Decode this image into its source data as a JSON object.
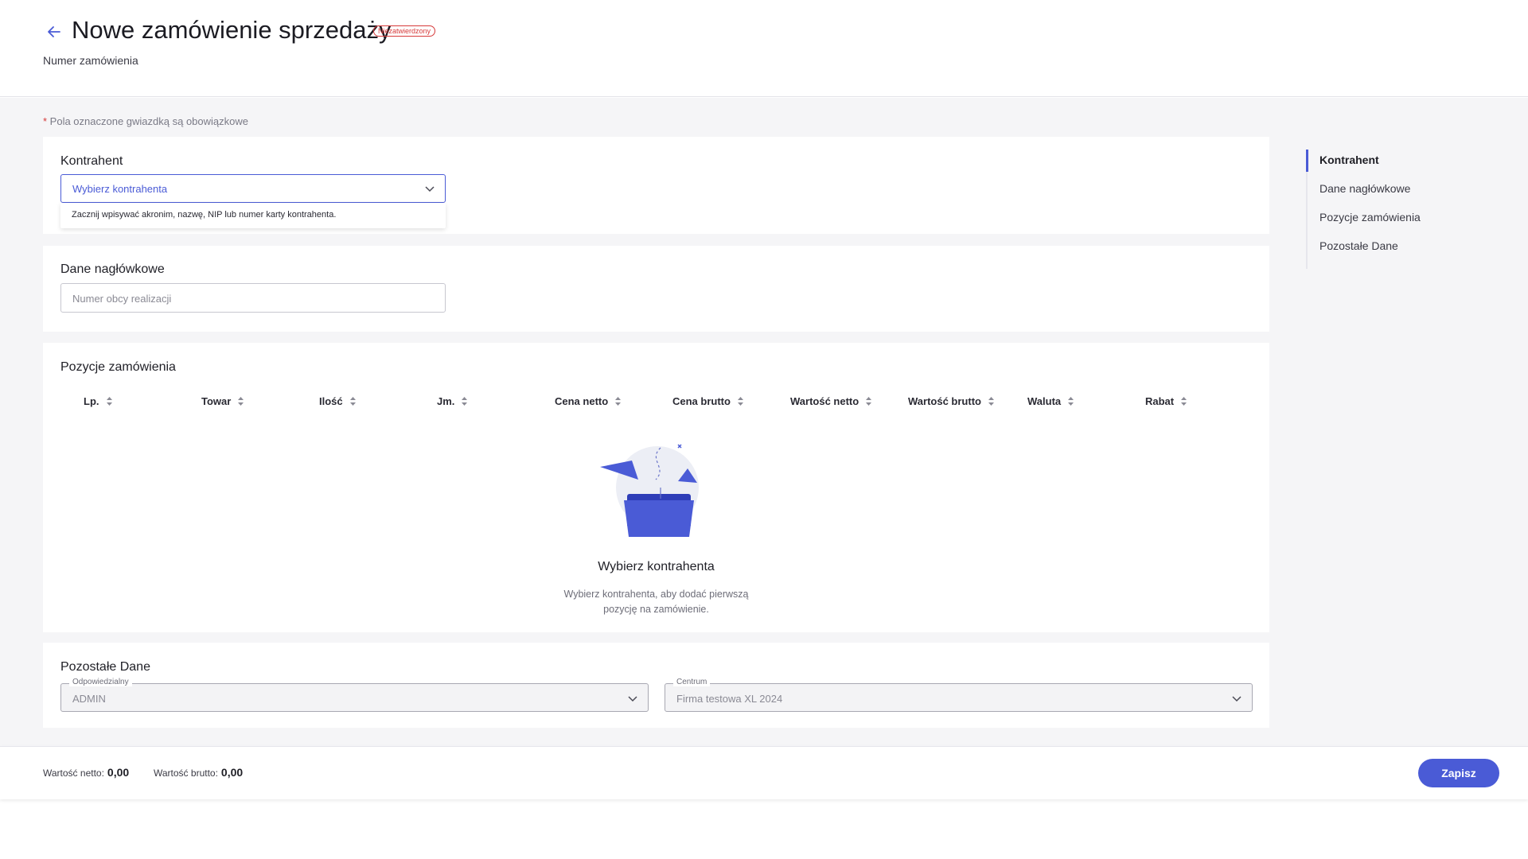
{
  "header": {
    "title": "Nowe zamówienie sprzedaży",
    "status_badge": "Niezatwierdzony",
    "order_number_label": "Numer zamówienia"
  },
  "required_note": {
    "star": "*",
    "text": " Pola oznaczone gwiazdką są obowiązkowe"
  },
  "kontrahent": {
    "title": "Kontrahent",
    "select_value": "Wybierz kontrahenta",
    "hint": "Zacznij wpisywać akronim, nazwę, NIP lub numer karty kontrahenta."
  },
  "dane_naglowkowe": {
    "title": "Dane nagłówkowe",
    "foreign_number_placeholder": "Numer obcy realizacji"
  },
  "pozycje": {
    "title": "Pozycje zamówienia",
    "columns": [
      "Lp.",
      "Towar",
      "Ilość",
      "Jm.",
      "Cena netto",
      "Cena brutto",
      "Wartość netto",
      "Wartość brutto",
      "Waluta",
      "Rabat"
    ],
    "empty_title": "Wybierz kontrahenta",
    "empty_desc": "Wybierz kontrahenta, aby dodać pierwszą pozycję na zamówienie."
  },
  "pozostale": {
    "title": "Pozostałe Dane",
    "responsible_label": "Odpowiedzialny",
    "responsible_value": "ADMIN",
    "center_label": "Centrum",
    "center_value": "Firma testowa XL 2024"
  },
  "toc": {
    "items": [
      "Kontrahent",
      "Dane nagłówkowe",
      "Pozycje zamówienia",
      "Pozostałe Dane"
    ],
    "active_index": 0
  },
  "footer": {
    "net_label": "Wartość netto:",
    "net_value": "0,00",
    "gross_label": "Wartość brutto:",
    "gross_value": "0,00",
    "save_label": "Zapisz"
  },
  "colors": {
    "accent": "#4a5bd6",
    "status_red": "#d63a3a",
    "background": "#f5f5f7"
  },
  "icons": [
    "back-arrow-icon",
    "chevron-down-icon",
    "sort-icon",
    "empty-folder-illustration"
  ]
}
